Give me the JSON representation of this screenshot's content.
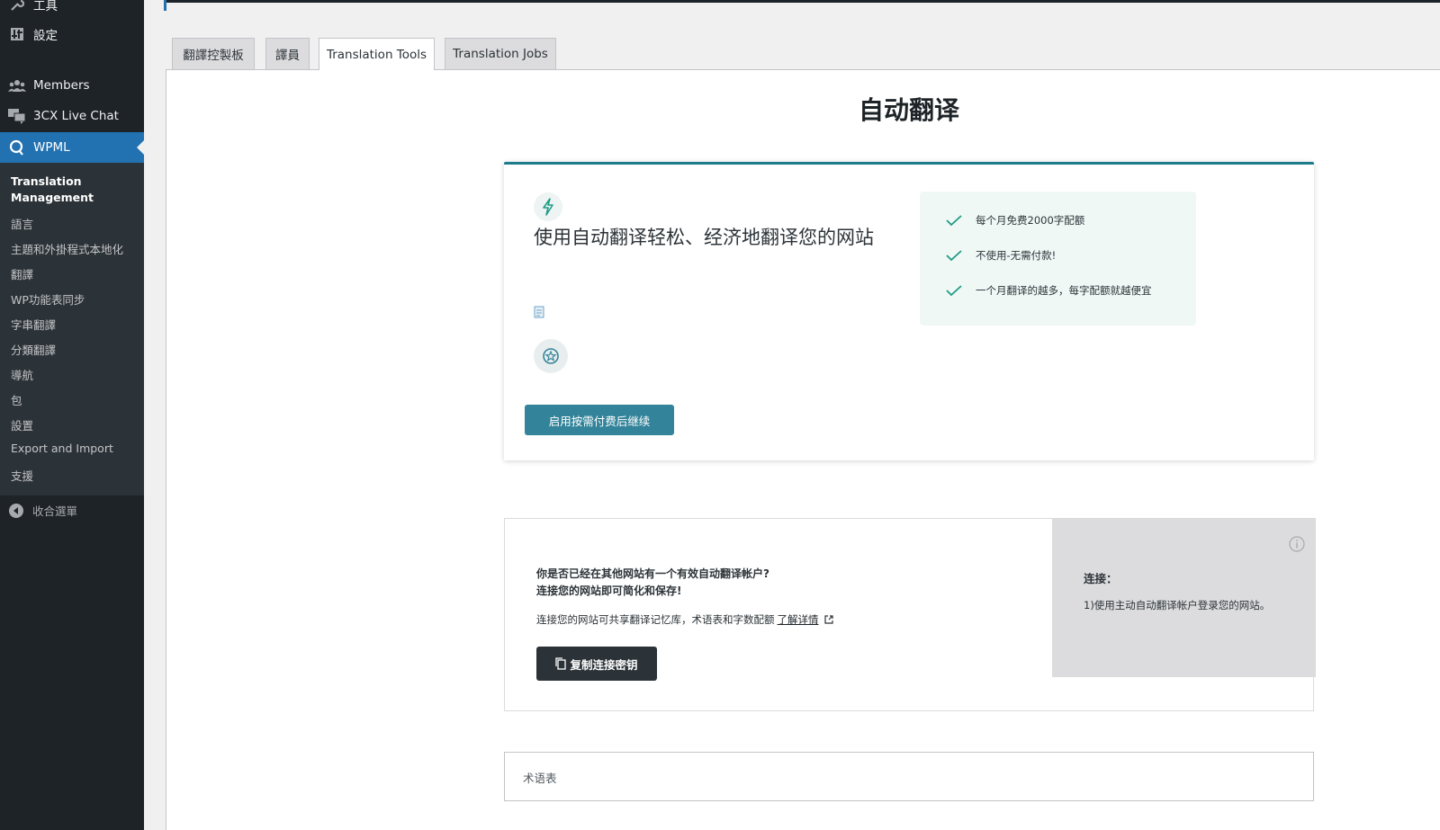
{
  "sidebar": {
    "items": [
      {
        "label": "工具",
        "icon": "wrench-icon"
      },
      {
        "label": "設定",
        "icon": "settings-sliders-icon"
      },
      {
        "label": "Members",
        "icon": "members-group-icon"
      },
      {
        "label": "3CX Live Chat",
        "icon": "chat-bubbles-icon"
      },
      {
        "label": "WPML",
        "icon": "wpml-logo-icon"
      }
    ],
    "submenu": [
      "Translation Management",
      "語言",
      "主題和外掛程式本地化",
      "翻譯",
      "WP功能表同步",
      "字串翻譯",
      "分類翻譯",
      "導航",
      "包",
      "設置",
      "Export and Import",
      "支援"
    ],
    "collapse_label": "收合選單"
  },
  "tabs": [
    "翻譯控製板",
    "譯員",
    "Translation Tools",
    "Translation Jobs"
  ],
  "active_tab": "Translation Tools",
  "page_title": "自动翻译",
  "auto_translate_card": {
    "title": "使用自动翻译轻松、经济地翻译您的网站",
    "benefits": [
      "每个月免费2000字配额",
      "不使用-无需付款!",
      "一个月翻译的越多，每字配额就越便宜"
    ],
    "button_label": "启用按需付费后继续",
    "accent_color": "#1f7a8c",
    "button_color": "#33849a"
  },
  "connect_card": {
    "question_line1": "你是否已经在其他网站有一个有效自动翻译帐户?",
    "question_line2": "连接您的网站即可简化和保存!",
    "description": "连接您的网站可共享翻译记忆库，术语表和字数配额",
    "learn_more": "了解详情",
    "copy_button": "复制连接密钥",
    "side_title": "连接：",
    "side_text": "1)使用主动自动翻译帐户登录您的网站。"
  },
  "glossary_card": {
    "label": "术语表"
  }
}
